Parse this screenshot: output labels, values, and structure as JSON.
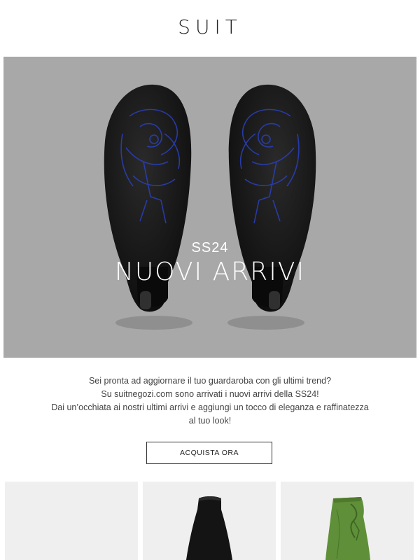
{
  "header": {
    "logo": "SUIT"
  },
  "hero": {
    "season": "SS24",
    "title": "NUOVI ARRIVI",
    "image": "black-leather-mules-soles-with-blue-equestrian-knight-print"
  },
  "intro": {
    "line1": "Sei pronta ad aggiornare il tuo guardaroba con gli ultimi trend?",
    "line2": "Su suitnegozi.com sono arrivati i nuovi arrivi della SS24!",
    "line3": "Dai un’occhiata ai nostri ultimi arrivi e aggiungi un tocco di eleganza e raffinatezza",
    "line4": "al tuo look!"
  },
  "cta": {
    "label": "ACQUISTA ORA"
  },
  "products": [
    {
      "image": "product-placeholder-light-grey"
    },
    {
      "image": "black-high-waisted-skirt"
    },
    {
      "image": "green-draped-wrap-skirt"
    }
  ],
  "colors": {
    "hero_background": "#a8a8a8",
    "shoe": "#161616",
    "print": "#2a3fb5",
    "skirt_green": "#5f8f38"
  }
}
